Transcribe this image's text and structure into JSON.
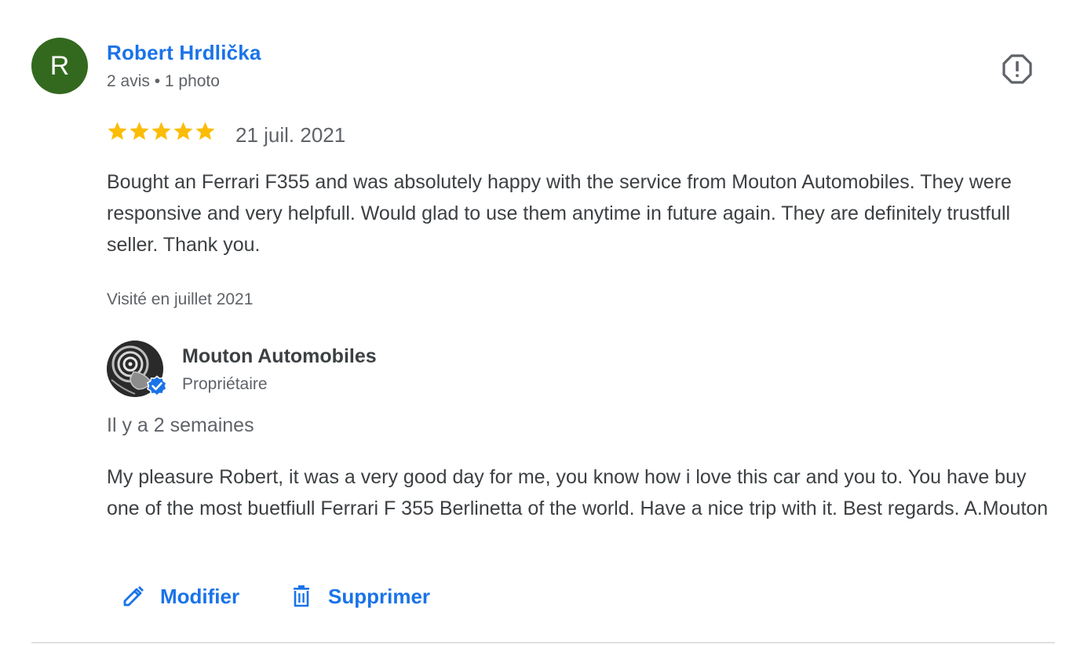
{
  "review": {
    "avatar_letter": "R",
    "avatar_color": "#33691e",
    "reviewer_name": "Robert Hrdlička",
    "reviewer_meta": "2 avis • 1 photo",
    "report_icon": "report-icon",
    "rating": 5,
    "rating_max": 5,
    "star_color": "#fbbc04",
    "date": "21 juil. 2021",
    "text": "Bought an Ferrari F355 and was absolutely happy with the service from Mouton Automobiles. They were responsive and very helpfull. Would glad to use them anytime in future again. They are definitely trustfull seller. Thank you.",
    "visited": "Visité en juillet 2021"
  },
  "owner_reply": {
    "owner_name": "Mouton Automobiles",
    "owner_role": "Propriétaire",
    "time": "Il y a 2 semaines",
    "text": "My pleasure Robert, it was a very good day for me, you know how i love this car and you to. You have buy one of the most buetfiull Ferrari F 355 Berlinetta of the world. Have a nice trip with it. Best regards. A.Mouton",
    "badge_icon": "verified-badge-icon",
    "badge_color": "#1a73e8"
  },
  "actions": {
    "edit_label": "Modifier",
    "edit_icon": "pencil-icon",
    "delete_label": "Supprimer",
    "delete_icon": "trash-icon"
  },
  "colors": {
    "link": "#1a73e8",
    "text": "#3c4043",
    "secondary": "#5f6368"
  }
}
